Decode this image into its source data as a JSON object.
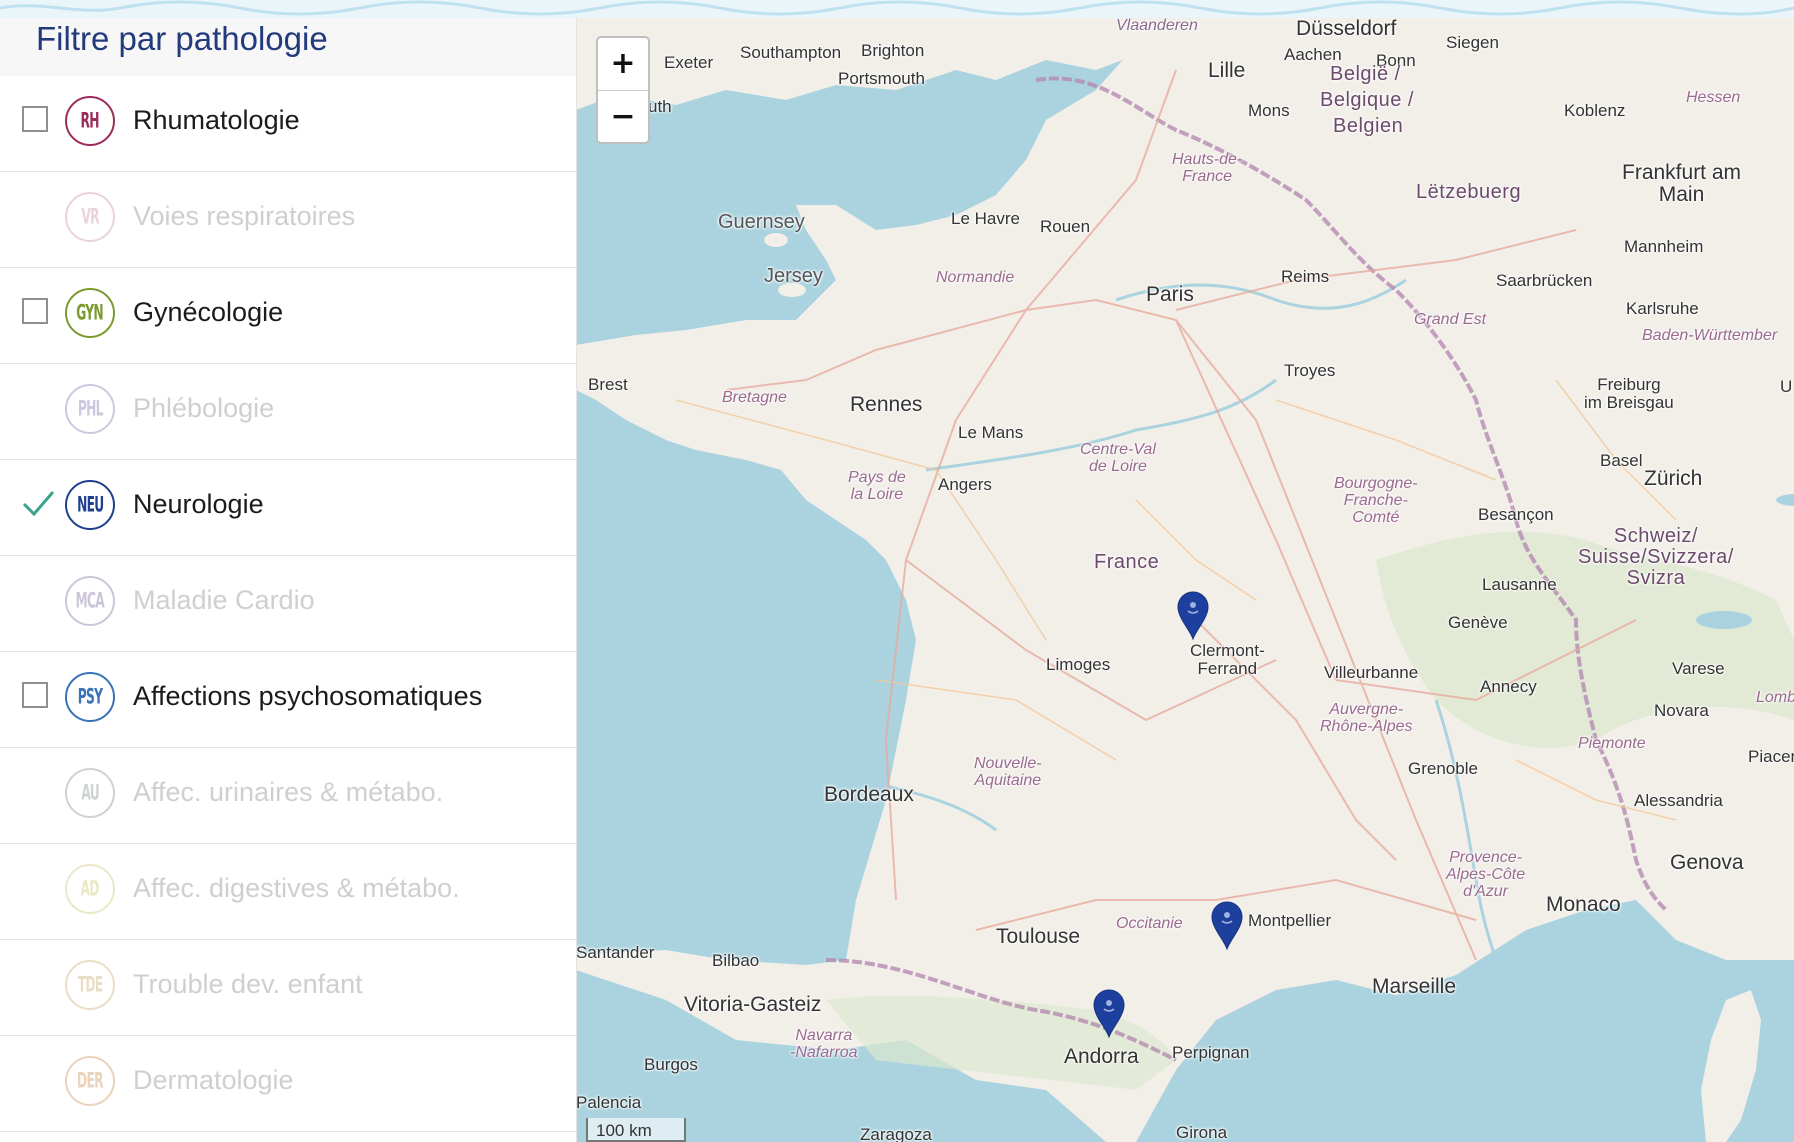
{
  "sidebar": {
    "title": "Filtre par pathologie",
    "items": [
      {
        "code": "RH",
        "label": "Rhumatologie",
        "color": "#9a2b5a",
        "state": "unchecked"
      },
      {
        "code": "VR",
        "label": "Voies respiratoires",
        "color": "#c98aa3",
        "state": "disabled"
      },
      {
        "code": "GYN",
        "label": "Gynécologie",
        "color": "#7a9a2e",
        "state": "unchecked"
      },
      {
        "code": "PHL",
        "label": "Phlébologie",
        "color": "#7d6fae",
        "state": "disabled"
      },
      {
        "code": "NEU",
        "label": "Neurologie",
        "color": "#1f3f8f",
        "state": "checked"
      },
      {
        "code": "MCA",
        "label": "Maladie Cardio",
        "color": "#7a6a9e",
        "state": "disabled"
      },
      {
        "code": "PSY",
        "label": "Affections psychosomatiques",
        "color": "#3a72b8",
        "state": "unchecked"
      },
      {
        "code": "AU",
        "label": "Affec. urinaires & métabo.",
        "color": "#7d8c8c",
        "state": "disabled"
      },
      {
        "code": "AD",
        "label": "Affec. digestives & métabo.",
        "color": "#c9c46a",
        "state": "disabled"
      },
      {
        "code": "TDE",
        "label": "Trouble dev. enfant",
        "color": "#c9a86a",
        "state": "disabled"
      },
      {
        "code": "DER",
        "label": "Dermatologie",
        "color": "#c98a4f",
        "state": "disabled"
      }
    ],
    "checkmark_color": "#3aa38e"
  },
  "map": {
    "zoom_in": "+",
    "zoom_out": "−",
    "scale": "100 km",
    "marker_color": "#1d3f9e",
    "labels": {
      "vlaanderen": "Vlaanderen",
      "dusseldorf": "Düsseldorf",
      "siegen": "Siegen",
      "exeter": "Exeter",
      "southampton": "Southampton",
      "brighton": "Brighton",
      "aachen": "Aachen",
      "bonn": "Bonn",
      "portsmouth": "Portsmouth",
      "lille": "Lille",
      "belgie1": "België /",
      "belgie2": "Belgique /",
      "belgie3": "Belgien",
      "uth": "uth",
      "mons": "Mons",
      "koblenz": "Koblenz",
      "hessen": "Hessen",
      "hauts": "Hauts-de-\nFrance",
      "frankfurt": "Frankfurt am\nMain",
      "letzebuerg": "Lëtzebuerg",
      "guernsey": "Guernsey",
      "lehavre": "Le Havre",
      "rouen": "Rouen",
      "mannheim": "Mannheim",
      "jersey": "Jersey",
      "normandie": "Normandie",
      "reims": "Reims",
      "saarbrucken": "Saarbrücken",
      "paris": "Paris",
      "karlsruhe": "Karlsruhe",
      "grandest": "Grand Est",
      "badenw": "Baden-Württember",
      "brest": "Brest",
      "troyes": "Troyes",
      "freiburg": "Freiburg\nim Breisgau",
      "bretagne": "Bretagne",
      "rennes": "Rennes",
      "lemans": "Le Mans",
      "centreval": "Centre-Val\nde Loire",
      "basel": "Basel",
      "paysloire": "Pays de\nla Loire",
      "angers": "Angers",
      "zurich": "Zürich",
      "bourgogne": "Bourgogne-\nFranche-\nComté",
      "besancon": "Besançon",
      "schweiz": "Schweiz/\nSuisse/Svizzera/\nSvizra",
      "france": "France",
      "lausanne": "Lausanne",
      "geneve": "Genève",
      "clermont": "Clermont-\nFerrand",
      "limoges": "Limoges",
      "villeurbanne": "Villeurbanne",
      "annecy": "Annecy",
      "varese": "Varese",
      "lombard": "Lombar",
      "auvergne": "Auvergne-\nRhône-Alpes",
      "novara": "Novara",
      "nouvelle": "Nouvelle-\nAquitaine",
      "piemonte": "Piemonte",
      "piacen": "Piacenz",
      "grenoble": "Grenoble",
      "bordeaux": "Bordeaux",
      "alessandria": "Alessandria",
      "genova": "Genova",
      "provence": "Provence-\nAlpes-Côte\nd'Azur",
      "monaco": "Monaco",
      "occitanie": "Occitanie",
      "montpellier": "Montpellier",
      "toulouse": "Toulouse",
      "santander": "Santander",
      "bilbao": "Bilbao",
      "marseille": "Marseille",
      "vitoria": "Vitoria-Gasteiz",
      "navarra": "Navarra\n-Nafarroa",
      "andorra": "Andorra",
      "perpignan": "Perpignan",
      "burgos": "Burgos",
      "palencia": "Palencia",
      "zaragoza": "Zaragoza",
      "girona": "Girona",
      "u": "U"
    }
  }
}
